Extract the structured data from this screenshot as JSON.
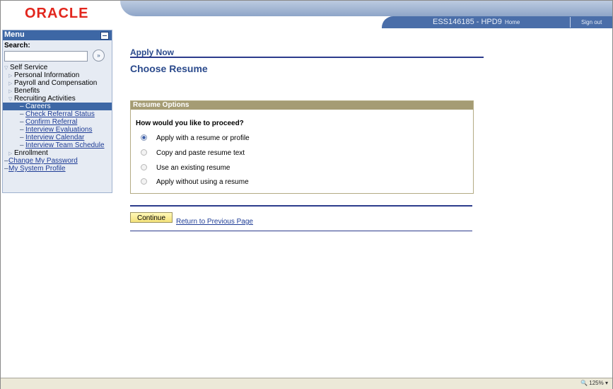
{
  "header": {
    "logo": "ORACLE",
    "system": "ESS146185 - HPD9",
    "home_label": "Home",
    "signout_label": "Sign out"
  },
  "menu": {
    "title": "Menu",
    "search_label": "Search:",
    "search_value": "",
    "search_go": "»",
    "items": [
      {
        "label": "Self Service"
      },
      {
        "label": "Personal Information"
      },
      {
        "label": "Payroll and Compensation"
      },
      {
        "label": "Benefits"
      },
      {
        "label": "Recruiting Activities"
      },
      {
        "label": "Careers"
      },
      {
        "label": "Check Referral Status"
      },
      {
        "label": "Confirm Referral"
      },
      {
        "label": "Interview Evaluations"
      },
      {
        "label": "Interview Calendar"
      },
      {
        "label": "Interview Team Schedule"
      },
      {
        "label": "Enrollment"
      },
      {
        "label": "Change My Password"
      },
      {
        "label": "My System Profile"
      }
    ]
  },
  "main": {
    "breadcrumb": "Apply Now",
    "title": "Choose Resume",
    "group_title": "Resume Options",
    "question": "How would you like to proceed?",
    "options": [
      {
        "label": "Apply with a resume or profile",
        "selected": true
      },
      {
        "label": "Copy and paste resume text",
        "selected": false
      },
      {
        "label": "Use an existing resume",
        "selected": false
      },
      {
        "label": "Apply without using a resume",
        "selected": false
      }
    ],
    "continue_label": "Continue",
    "return_label": "Return to Previous Page"
  },
  "status": {
    "zoom": "125%"
  },
  "colors": {
    "accent": "#3d67a5",
    "group_header": "#a59c74",
    "button": "#f3e17a",
    "logo": "#e2261d"
  }
}
